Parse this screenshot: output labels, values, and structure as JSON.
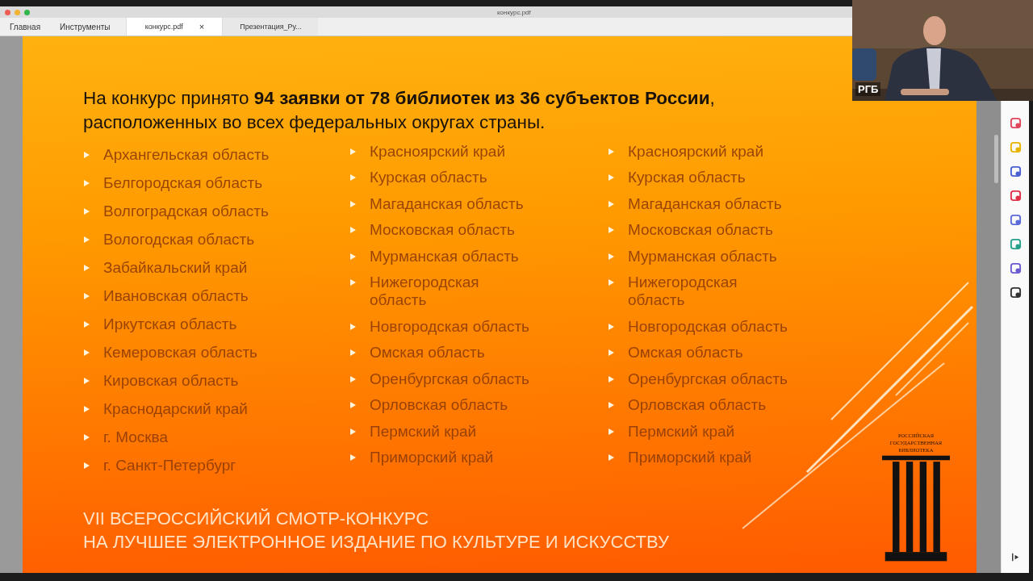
{
  "window": {
    "title": "конкурс.pdf"
  },
  "menu": [
    {
      "label": "Главная",
      "selected": false
    },
    {
      "label": "Инструменты",
      "selected": false
    }
  ],
  "tabs": [
    {
      "label": "конкурс.pdf",
      "selected": true,
      "close": "×"
    },
    {
      "label": "Презентация_Ру...",
      "selected": false
    }
  ],
  "slide": {
    "heading": "На конкурс принято **94 заявки от 78 библиотек из 36 субъектов России**, расположенных во всех федеральных округах страны.",
    "columns": [
      [
        "Архангельская область",
        "Белгородская область",
        "Волгоградская область",
        "Вологодская область",
        "Забайкальский край",
        "Ивановская область",
        "Иркутская область",
        "Кемеровская область",
        "Кировская область",
        "Краснодарский край",
        "г. Москва",
        "г. Санкт-Петербург"
      ],
      [
        "Красноярский край",
        "Курская область",
        "Магаданская область",
        "Московская область",
        "Мурманская область",
        "Нижегородская\nобласть",
        "Новгородская область",
        "Омская область",
        "Оренбургская область",
        "Орловская область",
        "Пермский край",
        "Приморский край"
      ],
      [
        "Красноярский край",
        "Курская область",
        "Магаданская область",
        "Московская область",
        "Мурманская область",
        "Нижегородская\nобласть",
        "Новгородская область",
        "Омская область",
        "Оренбургская область",
        "Орловская область",
        "Пермский край",
        "Приморский край"
      ]
    ],
    "footer": [
      "VII ВСЕРОССИЙСКИЙ СМОТР-КОНКУРС",
      "НА ЛУЧШЕЕ ЭЛЕКТРОННОЕ ИЗДАНИЕ ПО КУЛЬТУРЕ И ИСКУССТВУ"
    ],
    "logo": [
      "РОССИЙСКАЯ",
      "ГОСУДАРСТВЕННАЯ",
      "БИБЛИОТЕКА"
    ]
  },
  "video": {
    "name": "РГБ"
  }
}
